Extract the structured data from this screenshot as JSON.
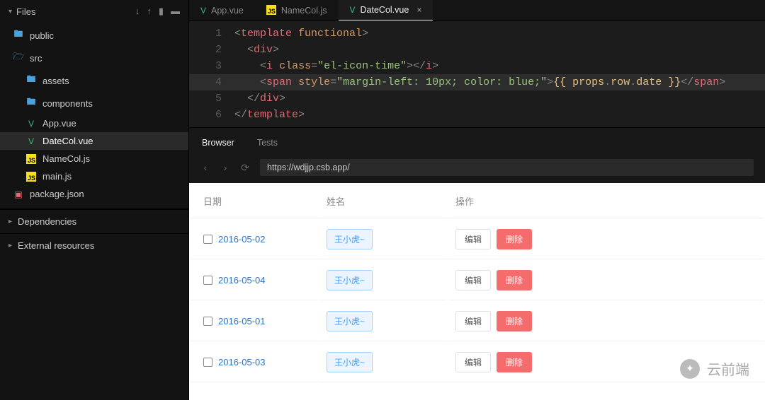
{
  "sidebar": {
    "title": "Files",
    "items": [
      {
        "label": "public",
        "icon": "folder",
        "indent": 0,
        "active": false
      },
      {
        "label": "src",
        "icon": "folder-open",
        "indent": 0,
        "active": false
      },
      {
        "label": "assets",
        "icon": "folder",
        "indent": 1,
        "active": false
      },
      {
        "label": "components",
        "icon": "folder",
        "indent": 1,
        "active": false
      },
      {
        "label": "App.vue",
        "icon": "vue",
        "indent": 1,
        "active": false
      },
      {
        "label": "DateCol.vue",
        "icon": "vue",
        "indent": 1,
        "active": true
      },
      {
        "label": "NameCol.js",
        "icon": "js",
        "indent": 1,
        "active": false
      },
      {
        "label": "main.js",
        "icon": "js",
        "indent": 1,
        "active": false
      },
      {
        "label": "package.json",
        "icon": "json",
        "indent": 0,
        "active": false
      }
    ],
    "sections": [
      {
        "label": "Dependencies"
      },
      {
        "label": "External resources"
      }
    ]
  },
  "tabs": [
    {
      "label": "App.vue",
      "icon": "vue",
      "active": false,
      "closable": false
    },
    {
      "label": "NameCol.js",
      "icon": "js",
      "active": false,
      "closable": false
    },
    {
      "label": "DateCol.vue",
      "icon": "vue",
      "active": true,
      "closable": true
    }
  ],
  "code_lines": [
    {
      "n": "1",
      "indent": "",
      "html": "<span class='t-punc'>&lt;</span><span class='t-tag'>template</span> <span class='t-attr'>functional</span><span class='t-punc'>&gt;</span>"
    },
    {
      "n": "2",
      "indent": "  ",
      "html": "<span class='t-punc'>&lt;</span><span class='t-tag'>div</span><span class='t-punc'>&gt;</span>"
    },
    {
      "n": "3",
      "indent": "    ",
      "html": "<span class='t-punc'>&lt;</span><span class='t-tag'>i</span> <span class='t-attr'>class</span><span class='t-op'>=</span><span class='t-str'>\"el-icon-time\"</span><span class='t-punc'>&gt;&lt;/</span><span class='t-tag'>i</span><span class='t-punc'>&gt;</span>"
    },
    {
      "n": "4",
      "indent": "    ",
      "hl": true,
      "html": "<span class='t-punc'>&lt;</span><span class='t-tag'>span</span> <span class='t-attr'>style</span><span class='t-op'>=</span><span class='t-str'>\"margin-left: 10px; color: blue;\"</span><span class='t-punc'>&gt;</span><span class='t-expr'>{{ props</span><span class='t-op'>.</span><span class='t-expr'>row</span><span class='t-op'>.</span><span class='t-expr'>date }}</span><span class='t-punc'>&lt;/</span><span class='t-tag'>span</span><span class='t-punc'>&gt;</span>"
    },
    {
      "n": "5",
      "indent": "  ",
      "html": "<span class='t-punc'>&lt;/</span><span class='t-tag'>div</span><span class='t-punc'>&gt;</span>"
    },
    {
      "n": "6",
      "indent": "",
      "html": "<span class='t-punc'>&lt;/</span><span class='t-tag'>template</span><span class='t-punc'>&gt;</span>"
    }
  ],
  "panel_tabs": {
    "browser": "Browser",
    "tests": "Tests",
    "active": "browser"
  },
  "browser": {
    "url": "https://wdjjp.csb.app/"
  },
  "preview_table": {
    "headers": {
      "date": "日期",
      "name": "姓名",
      "ops": "操作"
    },
    "op_labels": {
      "edit": "编辑",
      "delete": "删除"
    },
    "name_label": "王小虎~",
    "rows": [
      {
        "date": "2016-05-02"
      },
      {
        "date": "2016-05-04"
      },
      {
        "date": "2016-05-01"
      },
      {
        "date": "2016-05-03"
      }
    ]
  },
  "watermark": {
    "text": "云前端"
  }
}
